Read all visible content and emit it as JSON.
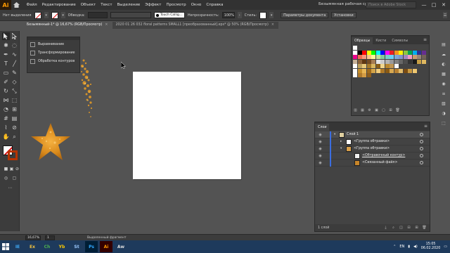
{
  "app": {
    "logo": "Ai",
    "menu": [
      "Файл",
      "Редактирование",
      "Объект",
      "Текст",
      "Выделение",
      "Эффект",
      "Просмотр",
      "Окно",
      "Справка"
    ],
    "workspace": "Безымянная рабочая среда 1",
    "stock_search_placeholder": "Поиск в Adobe Stock",
    "window_buttons": [
      "—",
      "□",
      "✕"
    ]
  },
  "controlbar": {
    "no_selection": "Нет выделения",
    "stroke_label": "Обводка:",
    "brush_name": "Touch Callig...",
    "opacity_label": "Непрозрачность:",
    "opacity_value": "100%",
    "style_label": "Стиль:",
    "doc_settings": "Параметры документа",
    "preferences": "Установки"
  },
  "doc_tabs": [
    {
      "label": "Безымянный-1* @ 16,67% (RGB/Просмотр)",
      "active": true
    },
    {
      "label": "2020 01 26 032 floral patterns SMALL1 [преобразованный].eps* @ 50% (RGB/Просмотр)",
      "active": false
    }
  ],
  "float_panel": {
    "items": [
      "Выравнивание",
      "Трансформирование",
      "Обработка контуров"
    ]
  },
  "swatches_panel": {
    "tabs": [
      "Образцы",
      "Кисти",
      "Символы"
    ],
    "active_tab": "Образцы",
    "rows": [
      [
        "#ffffff"
      ],
      [
        "#ffffff",
        "#000000",
        "#ff0000",
        "#ffff00",
        "#00ff00",
        "#00ffff",
        "#0000ff",
        "#ff00ff",
        "#ed1c24",
        "#f7941d",
        "#fff200",
        "#8dc63f",
        "#00a651",
        "#00aeef",
        "#2e3192",
        "#662d91"
      ],
      [
        "#ec008c",
        "#f26c4f",
        "#f7977a",
        "#fdc68a",
        "#fff799",
        "#c4df9b",
        "#82ca9c",
        "#7accc8",
        "#6dcff6",
        "#7da7d9",
        "#8493ca",
        "#a187be",
        "#f49ac2",
        "#c69c6d",
        "#998675",
        "#736357"
      ],
      [
        "#c7b299",
        "#8c6239",
        "#603813",
        "#754c24",
        "#a67c52",
        "#e6e6e6",
        "#cccccc",
        "#b3b3b3",
        "#999999",
        "#808080",
        "#666666",
        "#4d4d4d",
        "#333333",
        "#1a1a1a",
        "#c8a045",
        "#e0b860"
      ],
      [
        "#ffffff",
        "#bda15c",
        "#e8c87a",
        "#a67a2a",
        "#d9b65e",
        "#8a5e18",
        "#f0d58c",
        "#b8862d",
        "#c09550",
        "#ffffff"
      ],
      [
        "#ffffff",
        "#c8902c",
        "#e8b656",
        "#9e6a1c",
        "#d4a448",
        "#f2cc7a",
        "#b07a28",
        "#8a5a14",
        "#d8a850",
        "#b88030",
        "#e2bc6a",
        "#7a4c12",
        "#c89840",
        "#f0c870"
      ],
      [
        "#ffffff",
        "#b07a2c",
        "#d49c44",
        "#8c5c1c"
      ]
    ]
  },
  "layers_panel": {
    "title": "Слои",
    "rows": [
      {
        "name": "Слой 1",
        "level": 0,
        "expanded": true,
        "selected": true
      },
      {
        "name": "<Группа обтравки>",
        "level": 1,
        "expanded": false,
        "selected": false
      },
      {
        "name": "<Группа обтравки>",
        "level": 1,
        "expanded": true,
        "selected": false
      },
      {
        "name": "<Обтравочный контур>",
        "level": 2,
        "selected": false,
        "underline": true
      },
      {
        "name": "<Связанный файл>",
        "level": 2,
        "selected": false
      }
    ],
    "footer_count": "1 слой"
  },
  "statusbar": {
    "zoom": "16,67%",
    "artboard": "1",
    "status": "Выделенный фрагмент"
  },
  "taskbar": {
    "apps": [
      "IE",
      "Ex",
      "Ch",
      "Yb",
      "St",
      "Ps",
      "Ai",
      "Aw"
    ],
    "active_app": "Ai",
    "lang": "EN",
    "time": "15:05",
    "date": "06.02.2020"
  },
  "colors": {
    "accent_orange": "#ff9a00",
    "layer_color": "#3b6de0",
    "gold": "#d4922a"
  }
}
